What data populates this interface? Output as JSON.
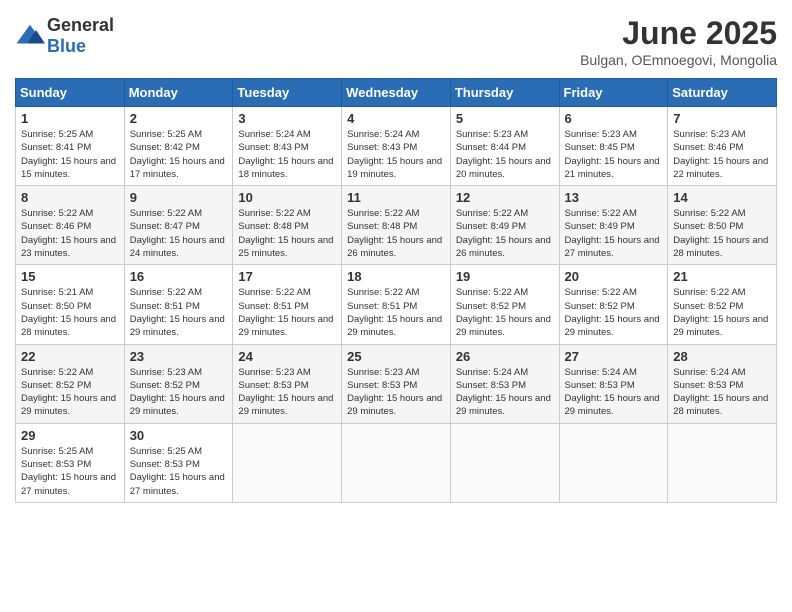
{
  "logo": {
    "text_general": "General",
    "text_blue": "Blue"
  },
  "header": {
    "title": "June 2025",
    "subtitle": "Bulgan, OEmnoegovi, Mongolia"
  },
  "days_of_week": [
    "Sunday",
    "Monday",
    "Tuesday",
    "Wednesday",
    "Thursday",
    "Friday",
    "Saturday"
  ],
  "weeks": [
    [
      {
        "day": "1",
        "sunrise": "5:25 AM",
        "sunset": "8:41 PM",
        "daylight": "15 hours and 15 minutes."
      },
      {
        "day": "2",
        "sunrise": "5:25 AM",
        "sunset": "8:42 PM",
        "daylight": "15 hours and 17 minutes."
      },
      {
        "day": "3",
        "sunrise": "5:24 AM",
        "sunset": "8:43 PM",
        "daylight": "15 hours and 18 minutes."
      },
      {
        "day": "4",
        "sunrise": "5:24 AM",
        "sunset": "8:43 PM",
        "daylight": "15 hours and 19 minutes."
      },
      {
        "day": "5",
        "sunrise": "5:23 AM",
        "sunset": "8:44 PM",
        "daylight": "15 hours and 20 minutes."
      },
      {
        "day": "6",
        "sunrise": "5:23 AM",
        "sunset": "8:45 PM",
        "daylight": "15 hours and 21 minutes."
      },
      {
        "day": "7",
        "sunrise": "5:23 AM",
        "sunset": "8:46 PM",
        "daylight": "15 hours and 22 minutes."
      }
    ],
    [
      {
        "day": "8",
        "sunrise": "5:22 AM",
        "sunset": "8:46 PM",
        "daylight": "15 hours and 23 minutes."
      },
      {
        "day": "9",
        "sunrise": "5:22 AM",
        "sunset": "8:47 PM",
        "daylight": "15 hours and 24 minutes."
      },
      {
        "day": "10",
        "sunrise": "5:22 AM",
        "sunset": "8:48 PM",
        "daylight": "15 hours and 25 minutes."
      },
      {
        "day": "11",
        "sunrise": "5:22 AM",
        "sunset": "8:48 PM",
        "daylight": "15 hours and 26 minutes."
      },
      {
        "day": "12",
        "sunrise": "5:22 AM",
        "sunset": "8:49 PM",
        "daylight": "15 hours and 26 minutes."
      },
      {
        "day": "13",
        "sunrise": "5:22 AM",
        "sunset": "8:49 PM",
        "daylight": "15 hours and 27 minutes."
      },
      {
        "day": "14",
        "sunrise": "5:22 AM",
        "sunset": "8:50 PM",
        "daylight": "15 hours and 28 minutes."
      }
    ],
    [
      {
        "day": "15",
        "sunrise": "5:21 AM",
        "sunset": "8:50 PM",
        "daylight": "15 hours and 28 minutes."
      },
      {
        "day": "16",
        "sunrise": "5:22 AM",
        "sunset": "8:51 PM",
        "daylight": "15 hours and 29 minutes."
      },
      {
        "day": "17",
        "sunrise": "5:22 AM",
        "sunset": "8:51 PM",
        "daylight": "15 hours and 29 minutes."
      },
      {
        "day": "18",
        "sunrise": "5:22 AM",
        "sunset": "8:51 PM",
        "daylight": "15 hours and 29 minutes."
      },
      {
        "day": "19",
        "sunrise": "5:22 AM",
        "sunset": "8:52 PM",
        "daylight": "15 hours and 29 minutes."
      },
      {
        "day": "20",
        "sunrise": "5:22 AM",
        "sunset": "8:52 PM",
        "daylight": "15 hours and 29 minutes."
      },
      {
        "day": "21",
        "sunrise": "5:22 AM",
        "sunset": "8:52 PM",
        "daylight": "15 hours and 29 minutes."
      }
    ],
    [
      {
        "day": "22",
        "sunrise": "5:22 AM",
        "sunset": "8:52 PM",
        "daylight": "15 hours and 29 minutes."
      },
      {
        "day": "23",
        "sunrise": "5:23 AM",
        "sunset": "8:52 PM",
        "daylight": "15 hours and 29 minutes."
      },
      {
        "day": "24",
        "sunrise": "5:23 AM",
        "sunset": "8:53 PM",
        "daylight": "15 hours and 29 minutes."
      },
      {
        "day": "25",
        "sunrise": "5:23 AM",
        "sunset": "8:53 PM",
        "daylight": "15 hours and 29 minutes."
      },
      {
        "day": "26",
        "sunrise": "5:24 AM",
        "sunset": "8:53 PM",
        "daylight": "15 hours and 29 minutes."
      },
      {
        "day": "27",
        "sunrise": "5:24 AM",
        "sunset": "8:53 PM",
        "daylight": "15 hours and 29 minutes."
      },
      {
        "day": "28",
        "sunrise": "5:24 AM",
        "sunset": "8:53 PM",
        "daylight": "15 hours and 28 minutes."
      }
    ],
    [
      {
        "day": "29",
        "sunrise": "5:25 AM",
        "sunset": "8:53 PM",
        "daylight": "15 hours and 27 minutes."
      },
      {
        "day": "30",
        "sunrise": "5:25 AM",
        "sunset": "8:53 PM",
        "daylight": "15 hours and 27 minutes."
      },
      null,
      null,
      null,
      null,
      null
    ]
  ],
  "labels": {
    "sunrise": "Sunrise:",
    "sunset": "Sunset:",
    "daylight": "Daylight:"
  }
}
